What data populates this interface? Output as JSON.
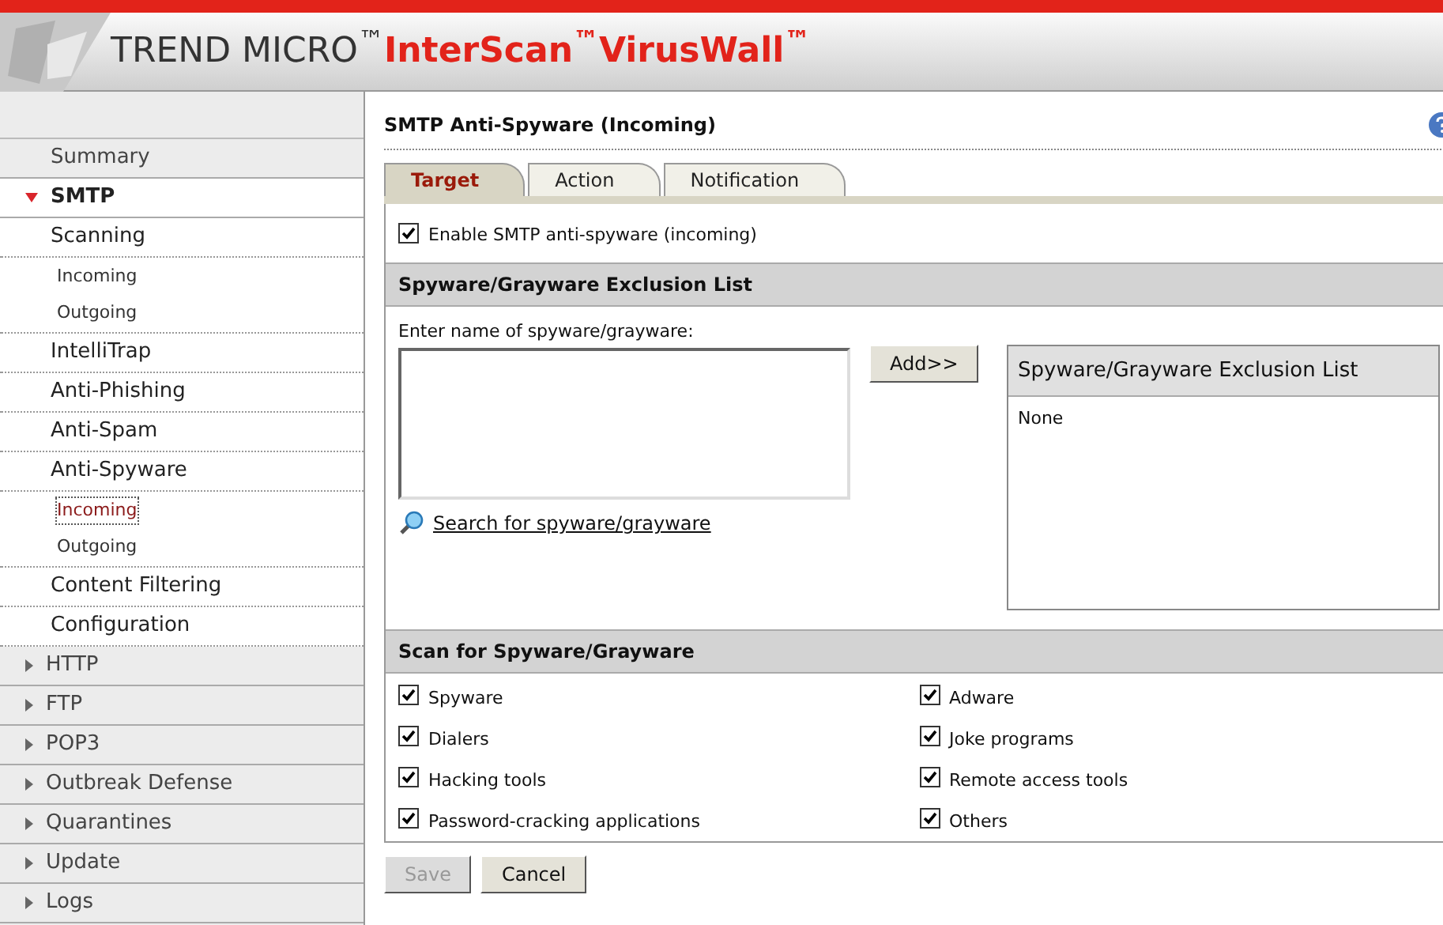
{
  "header": {
    "brand": "TREND MICRO$^{™}$",
    "product": "InterScan$^{™}$VirusWall$^{™}$"
  },
  "sidebar": {
    "items": [
      {
        "label": "Summary",
        "kind": "top"
      },
      {
        "label": "SMTP",
        "kind": "section",
        "expanded": true,
        "children": [
          {
            "label": "Scanning",
            "selected": false,
            "children": [
              {
                "label": "Incoming",
                "selected": false
              },
              {
                "label": "Outgoing",
                "selected": false
              }
            ]
          },
          {
            "label": "IntelliTrap",
            "selected": false
          },
          {
            "label": "Anti-Phishing",
            "selected": false
          },
          {
            "label": "Anti-Spam",
            "selected": false
          },
          {
            "label": "Anti-Spyware",
            "selected": false,
            "children": [
              {
                "label": "Incoming",
                "selected": true
              },
              {
                "label": "Outgoing",
                "selected": false
              }
            ]
          },
          {
            "label": "Content Filtering",
            "selected": false
          },
          {
            "label": "Configuration",
            "selected": false
          }
        ]
      },
      {
        "label": "HTTP",
        "kind": "section",
        "expanded": false
      },
      {
        "label": "FTP",
        "kind": "section",
        "expanded": false
      },
      {
        "label": "POP3",
        "kind": "section",
        "expanded": false
      },
      {
        "label": "Outbreak Defense",
        "kind": "section",
        "expanded": false
      },
      {
        "label": "Quarantines",
        "kind": "section",
        "expanded": false
      },
      {
        "label": "Update",
        "kind": "section",
        "expanded": false
      },
      {
        "label": "Logs",
        "kind": "section",
        "expanded": false
      }
    ]
  },
  "page": {
    "title": "SMTP Anti-Spyware (Incoming)",
    "tabs": [
      {
        "label": "Target",
        "selected": true
      },
      {
        "label": "Action",
        "selected": false
      },
      {
        "label": "Notification",
        "selected": false
      }
    ],
    "enable": {
      "label": "Enable SMTP anti-spyware (incoming)",
      "checked": true
    },
    "exclusion": {
      "heading": "Spyware/Grayware Exclusion List",
      "input_label": "Enter name of spyware/grayware:",
      "add_button": "Add>>",
      "search_link": "Search for spyware/grayware",
      "list_heading": "Spyware/Grayware Exclusion List",
      "list_items": [
        "None"
      ]
    },
    "scan": {
      "heading": "Scan for Spyware/Grayware",
      "options": [
        {
          "label": "Spyware",
          "checked": true
        },
        {
          "label": "Adware",
          "checked": true
        },
        {
          "label": "Dialers",
          "checked": true
        },
        {
          "label": "Joke programs",
          "checked": true
        },
        {
          "label": "Hacking tools",
          "checked": true
        },
        {
          "label": "Remote access tools",
          "checked": true
        },
        {
          "label": "Password-cracking applications",
          "checked": true
        },
        {
          "label": "Others",
          "checked": true
        }
      ]
    },
    "buttons": [
      {
        "label": "Save",
        "disabled": true
      },
      {
        "label": "Cancel",
        "disabled": false
      }
    ]
  }
}
